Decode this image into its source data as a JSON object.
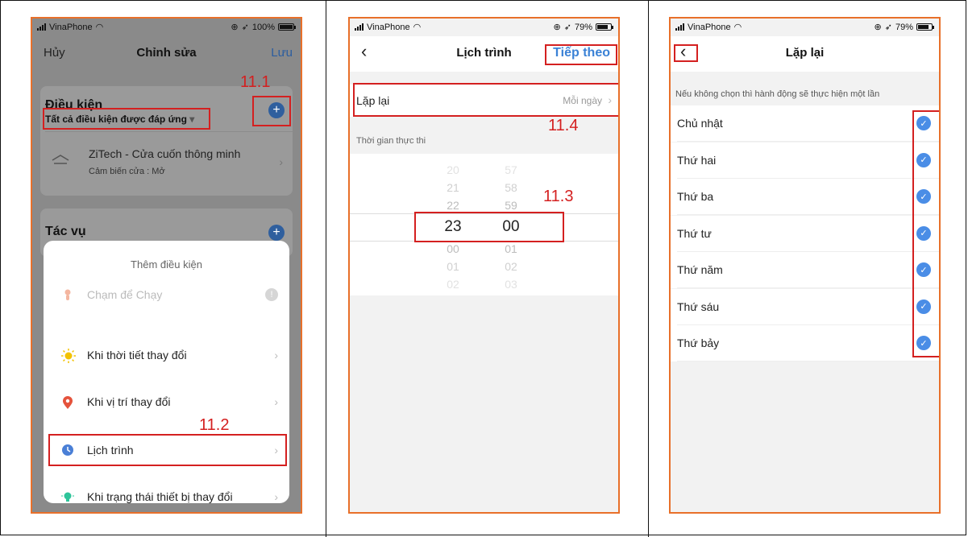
{
  "status_bars": [
    {
      "carrier": "VinaPhone",
      "battery_text": "100%",
      "battery_level": 1.0
    },
    {
      "carrier": "VinaPhone",
      "battery_text": "79%",
      "battery_level": 0.79
    },
    {
      "carrier": "VinaPhone",
      "battery_text": "79%",
      "battery_level": 0.79
    }
  ],
  "panel1": {
    "nav": {
      "left": "Hủy",
      "title": "Chỉnh sửa",
      "right": "Lưu"
    },
    "conditions": {
      "title": "Điều kiện",
      "filter": "Tất cả điều kiện được đáp ứng",
      "filter_caret": "▾"
    },
    "device": {
      "name": "ZiTech - Cửa cuốn thông minh",
      "detail": "Cảm biến cửa : Mở"
    },
    "tasks_title": "Tác vụ",
    "sheet": {
      "title": "Thêm điều kiện",
      "items": [
        {
          "label": "Chạm để Chạy",
          "icon": "hand-tap-icon",
          "color": "#f4b6a0",
          "disabled": true
        },
        {
          "label": "Khi thời tiết thay đổi",
          "icon": "sun-icon",
          "color": "#f2c200"
        },
        {
          "label": "Khi vị trí thay đổi",
          "icon": "location-pin-icon",
          "color": "#e5533c"
        },
        {
          "label": "Lịch trình",
          "icon": "clock-icon",
          "color": "#4a7fd6"
        },
        {
          "label": "Khi trạng thái thiết bị thay đổi",
          "icon": "device-bulb-icon",
          "color": "#2ec49a"
        }
      ]
    },
    "annotations": {
      "a1": "11.1",
      "a2": "11.2"
    }
  },
  "panel2": {
    "nav": {
      "back": "‹",
      "title": "Lịch trình",
      "right": "Tiếp theo"
    },
    "repeat": {
      "label": "Lặp lại",
      "value": "Mỗi ngày"
    },
    "section": "Thời gian thực thi",
    "picker": {
      "hours": [
        "20",
        "21",
        "22",
        "23",
        "00",
        "01",
        "02"
      ],
      "minutes": [
        "57",
        "58",
        "59",
        "00",
        "01",
        "02",
        "03"
      ],
      "selected_hour": "23",
      "selected_minute": "00"
    },
    "annotations": {
      "a3": "11.3",
      "a4": "11.4"
    }
  },
  "panel3": {
    "nav": {
      "back": "‹",
      "title": "Lặp lại"
    },
    "hint": "Nếu không chọn thì hành động sẽ thực hiện một lần",
    "days": [
      {
        "label": "Chủ nhật",
        "checked": true
      },
      {
        "label": "Thứ hai",
        "checked": true
      },
      {
        "label": "Thứ ba",
        "checked": true
      },
      {
        "label": "Thứ tư",
        "checked": true
      },
      {
        "label": "Thứ năm",
        "checked": true
      },
      {
        "label": "Thứ sáu",
        "checked": true
      },
      {
        "label": "Thứ bảy",
        "checked": true
      }
    ]
  },
  "colors": {
    "accent": "#3b82d6",
    "annotation": "#d42020",
    "phone_border": "#e8702a",
    "check": "#4a8de6"
  }
}
